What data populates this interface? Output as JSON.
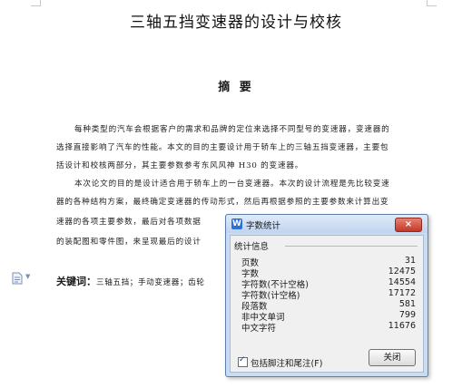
{
  "document": {
    "title": "三轴五挡变速器的设计与校核",
    "abstract_heading": "摘 要",
    "lines": [
      "每种类型的汽车会根据客户的需求和品牌的定位来选择不同型号的变速器，变速器的",
      "选择直接影响了汽车的性能。本文的目的主要设计用于轿车上的三轴五挡变速器，主要包",
      "括设计和校核两部分，其主要参数参考东风风神 H30 的变速器。",
      "本次论文的目的是设计适合用于轿车上的一台变速器。本次的设计流程是先比较变速",
      "器的各种结构方案，最终确定变速器的传动形式，然后再根据参照的主要参数来计算出变",
      "速器的各项主要参数，最后对各项数据",
      "的装配图和零件图，来呈现最后的设计"
    ],
    "keywords_label": "关键词：",
    "keywords_text": "三轴五挡；手动变速器；齿轮"
  },
  "dialog": {
    "title": "字数统计",
    "app_icon": "W",
    "close_label": "×",
    "group_label": "统计信息",
    "stats": [
      {
        "label": "页数",
        "value": "31"
      },
      {
        "label": "字数",
        "value": "12475"
      },
      {
        "label": "字符数(不计空格)",
        "value": "14554"
      },
      {
        "label": "字符数(计空格)",
        "value": "17172"
      },
      {
        "label": "段落数",
        "value": "581"
      },
      {
        "label": "非中文单词",
        "value": "799"
      },
      {
        "label": "中文字符",
        "value": "11676"
      }
    ],
    "checkbox_label": "包括脚注和尾注(F)",
    "checkbox_checked": true,
    "ok_label": "关闭"
  },
  "colors": {
    "dialog_frame": "#c9dcf2",
    "close_button": "#c0392b",
    "app_icon": "#2e6fd3"
  }
}
